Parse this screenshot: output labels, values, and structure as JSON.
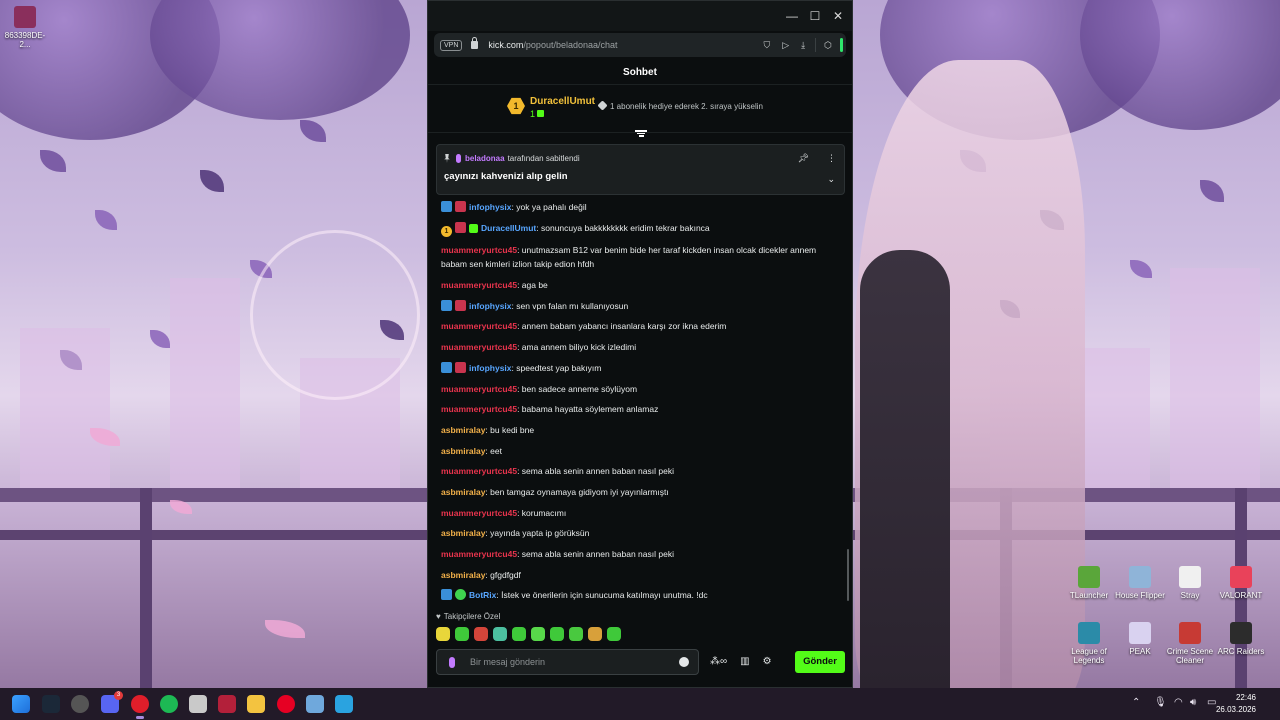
{
  "browser": {
    "vpn_label": "VPN",
    "url_host": "kick.com",
    "url_path": "/popout/beladonaa/chat",
    "minimize": "—",
    "maximize": "☐",
    "close": "✕"
  },
  "chat": {
    "header_title": "Sohbet",
    "leader": {
      "rank": "1",
      "name": "DuracellUmut",
      "count": "1",
      "info": "1 abonelik hediye ederek 2. sıraya yükselin"
    },
    "pinned": {
      "user": "beladonaa",
      "label": "tarafından sabitlendi",
      "message": "çayınızı kahvenizi alıp gelin"
    },
    "messages": [
      {
        "user": "infophysix",
        "color": "#58a6ff",
        "badges": [
          "blue",
          "red"
        ],
        "text": ": yok ya pahalı değil"
      },
      {
        "user": "DuracellUmut",
        "color": "#58a6ff",
        "badges": [
          "gold",
          "red",
          "green"
        ],
        "text": ": sonuncuya bakkkkkkkk eridim tekrar bakınca"
      },
      {
        "user": "muammeryurtcu45",
        "color": "#e8344d",
        "badges": [],
        "text": ": unutmazsam B12 var benim bide her taraf kickden insan olcak dicekler annem babam sen kimleri izlion takip edion hfdh"
      },
      {
        "user": "muammeryurtcu45",
        "color": "#e8344d",
        "badges": [],
        "text": ": aga be"
      },
      {
        "user": "infophysix",
        "color": "#58a6ff",
        "badges": [
          "blue",
          "red"
        ],
        "text": ": sen vpn falan mı kullanıyosun"
      },
      {
        "user": "muammeryurtcu45",
        "color": "#e8344d",
        "badges": [],
        "text": ": annem babam yabancı insanlara karşı zor ikna ederim"
      },
      {
        "user": "muammeryurtcu45",
        "color": "#e8344d",
        "badges": [],
        "text": ": ama annem biliyo kick izledimi"
      },
      {
        "user": "infophysix",
        "color": "#58a6ff",
        "badges": [
          "blue",
          "red"
        ],
        "text": ": speedtest yap bakıyım"
      },
      {
        "user": "muammeryurtcu45",
        "color": "#e8344d",
        "badges": [],
        "text": ": ben sadece anneme söylüyom"
      },
      {
        "user": "muammeryurtcu45",
        "color": "#e8344d",
        "badges": [],
        "text": ": babama hayatta söylemem anlamaz"
      },
      {
        "user": "asbmiralay",
        "color": "#f3b14a",
        "badges": [],
        "text": ": bu kedi bne"
      },
      {
        "user": "asbmiralay",
        "color": "#f3b14a",
        "badges": [],
        "text": ": eet"
      },
      {
        "user": "muammeryurtcu45",
        "color": "#e8344d",
        "badges": [],
        "text": ": sema abla senin annen baban nasıl peki"
      },
      {
        "user": "asbmiralay",
        "color": "#f3b14a",
        "badges": [],
        "text": ": ben tamgaz oynamaya gidiyom iyi yayınlarmıştı"
      },
      {
        "user": "muammeryurtcu45",
        "color": "#e8344d",
        "badges": [],
        "text": ": korumacımı"
      },
      {
        "user": "asbmiralay",
        "color": "#f3b14a",
        "badges": [],
        "text": ": yayında yapta ip görüksün"
      },
      {
        "user": "muammeryurtcu45",
        "color": "#e8344d",
        "badges": [],
        "text": ": sema abla senin annen baban nasıl peki"
      },
      {
        "user": "asbmiralay",
        "color": "#f3b14a",
        "badges": [],
        "text": ": gfgdfgdf"
      },
      {
        "user": "BotRix",
        "color": "#58a6ff",
        "badges": [
          "blue",
          "bot"
        ],
        "text": ": İstek ve önerilerin için sunucuma katılmayı unutma. !dc"
      }
    ],
    "followers_only_label": "Takipçilere Özel",
    "input_placeholder": "Bir mesaj gönderin",
    "send_label": "Gönder"
  },
  "desktop": {
    "top_left_icon": "863398DE-2...",
    "icons": [
      {
        "label": "TLauncher",
        "color": "#5aa63a"
      },
      {
        "label": "House Flipper",
        "color": "#8fb4d8"
      },
      {
        "label": "Stray",
        "color": "#f0f0f0"
      },
      {
        "label": "VALORANT",
        "color": "#e9425a"
      },
      {
        "label": "League of Legends",
        "color": "#2b8ba8"
      },
      {
        "label": "PEAK",
        "color": "#d9d2f0"
      },
      {
        "label": "Crime Scene Cleaner",
        "color": "#c73a34"
      },
      {
        "label": "ARC Raiders",
        "color": "#2c2c2c"
      }
    ]
  },
  "taskbar": {
    "time": "22:46",
    "date": "26.03.2026",
    "discord_badge": "3"
  }
}
